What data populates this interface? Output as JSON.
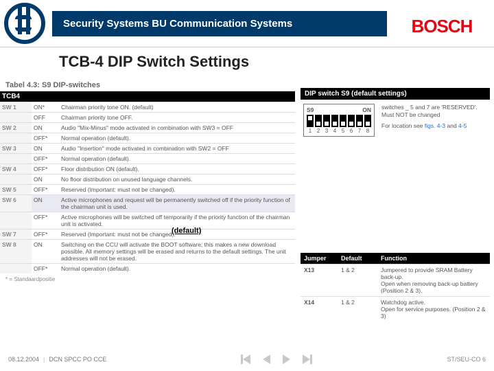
{
  "header": {
    "title": "Security Systems BU Communication Systems",
    "brand": "BOSCH"
  },
  "page_title": "TCB-4 DIP Switch Settings",
  "table_caption": "Tabel 4.3:  S9 DIP-switches",
  "board_label": "TCB4",
  "switches": [
    {
      "sw": "SW 1",
      "state": "ON*",
      "desc": "Chairman priority tone ON. (default)"
    },
    {
      "sw": "",
      "state": "OFF",
      "desc": "Chairman priority tone OFF."
    },
    {
      "sw": "SW 2",
      "state": "ON",
      "desc": "Audio \"Mix-Minus\" mode activated in combination with SW3 = OFF"
    },
    {
      "sw": "",
      "state": "OFF*",
      "desc": "Normal operation (default)."
    },
    {
      "sw": "SW 3",
      "state": "ON",
      "desc": "Audio \"Insertion\" mode activated in combination with SW2 = OFF"
    },
    {
      "sw": "",
      "state": "OFF*",
      "desc": "Normal operation (default)."
    },
    {
      "sw": "SW 4",
      "state": "OFF*",
      "desc": "Floor distribution ON (default)."
    },
    {
      "sw": "",
      "state": "ON",
      "desc": "No floor distribution on unused language channels."
    },
    {
      "sw": "SW 5",
      "state": "OFF*",
      "desc": "Reserved (Important: must not be changed)."
    },
    {
      "sw": "SW 6",
      "state": "ON",
      "desc": "Active microphones and request will be permanently switched off if the priority function of the chairman unit is used.",
      "hl": true
    },
    {
      "sw": "",
      "state": "OFF*",
      "desc": "Active microphones will be switched off temporarily if the priority function of the chairman unit is activated."
    },
    {
      "sw": "SW 7",
      "state": "OFF*",
      "desc": "Reserved (Important: must not be changed)."
    },
    {
      "sw": "SW 8",
      "state": "ON",
      "desc": "Switching on the CCU will activate the BOOT software; this makes a new download possible. All memory settings will be erased and returns to the default settings. The unit addresses will not be erased."
    },
    {
      "sw": "",
      "state": "OFF*",
      "desc": "Normal operation (default)."
    }
  ],
  "footnote_star": "* = Standaardpositie",
  "overlay_default": "(default)",
  "dip_panel": {
    "header": "DIP switch S9 (default settings)",
    "name": "S9",
    "on_label": "ON",
    "positions": [
      "up",
      "dn",
      "dn",
      "dn",
      "dn",
      "dn",
      "dn",
      "dn"
    ],
    "numbers": [
      "1",
      "2",
      "3",
      "4",
      "5",
      "6",
      "7",
      "8"
    ],
    "note_line1": "switches _ 5 and 7 are 'RESERVED'.",
    "note_line2": "Must NOT be changed",
    "note_line3": "For location see",
    "fig1": "figs. 4-3",
    "and": "and",
    "fig2": "4-5"
  },
  "jumper": {
    "headers": {
      "j": "Jumper",
      "d": "Default",
      "f": "Function"
    },
    "rows": [
      {
        "j": "X13",
        "d": "1 & 2",
        "f": "Jumpered to provide SRAM Battery back-up.\nOpen when removing back-up battery (Position 2 & 3)."
      },
      {
        "j": "X14",
        "d": "1 & 2",
        "f": "Watchdog active.\nOpen for service purposes. (Position 2 & 3)"
      }
    ]
  },
  "footer": {
    "date": "08.12.2004",
    "doc": "DCN SPCC PO CCE",
    "slide": "ST/SEU-CO 6"
  }
}
